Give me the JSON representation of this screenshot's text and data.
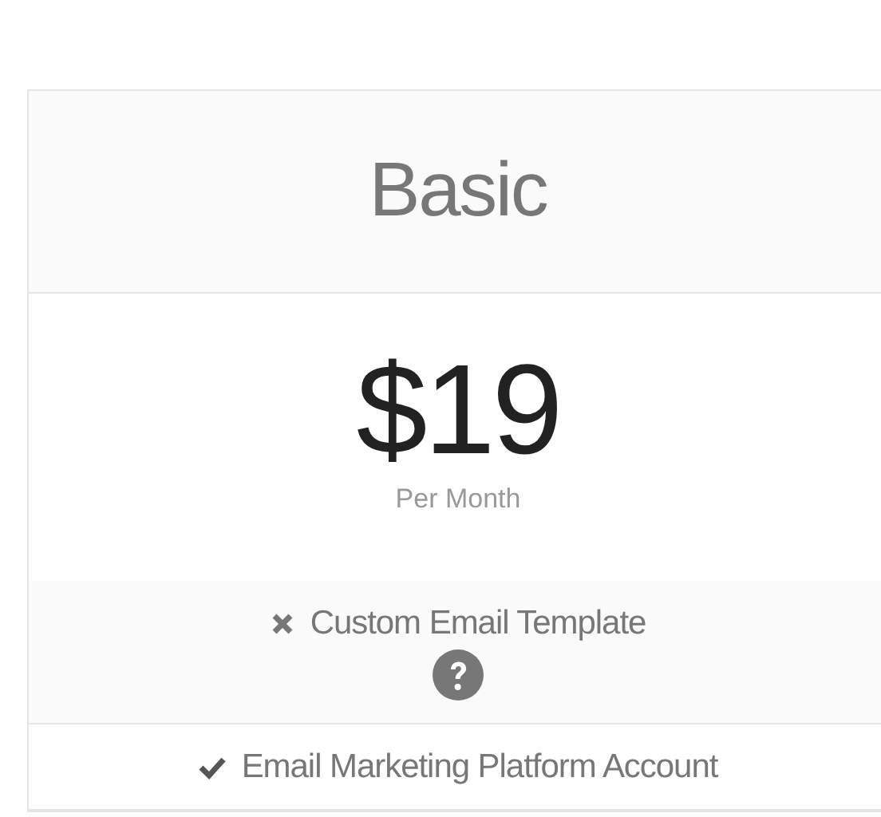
{
  "plan": {
    "name": "Basic",
    "price": "$19",
    "period": "Per Month"
  },
  "features": [
    {
      "label": "Custom Email Template",
      "included": false,
      "help": true
    },
    {
      "label": "Email Marketing Platform Account",
      "included": true,
      "help": false
    }
  ]
}
